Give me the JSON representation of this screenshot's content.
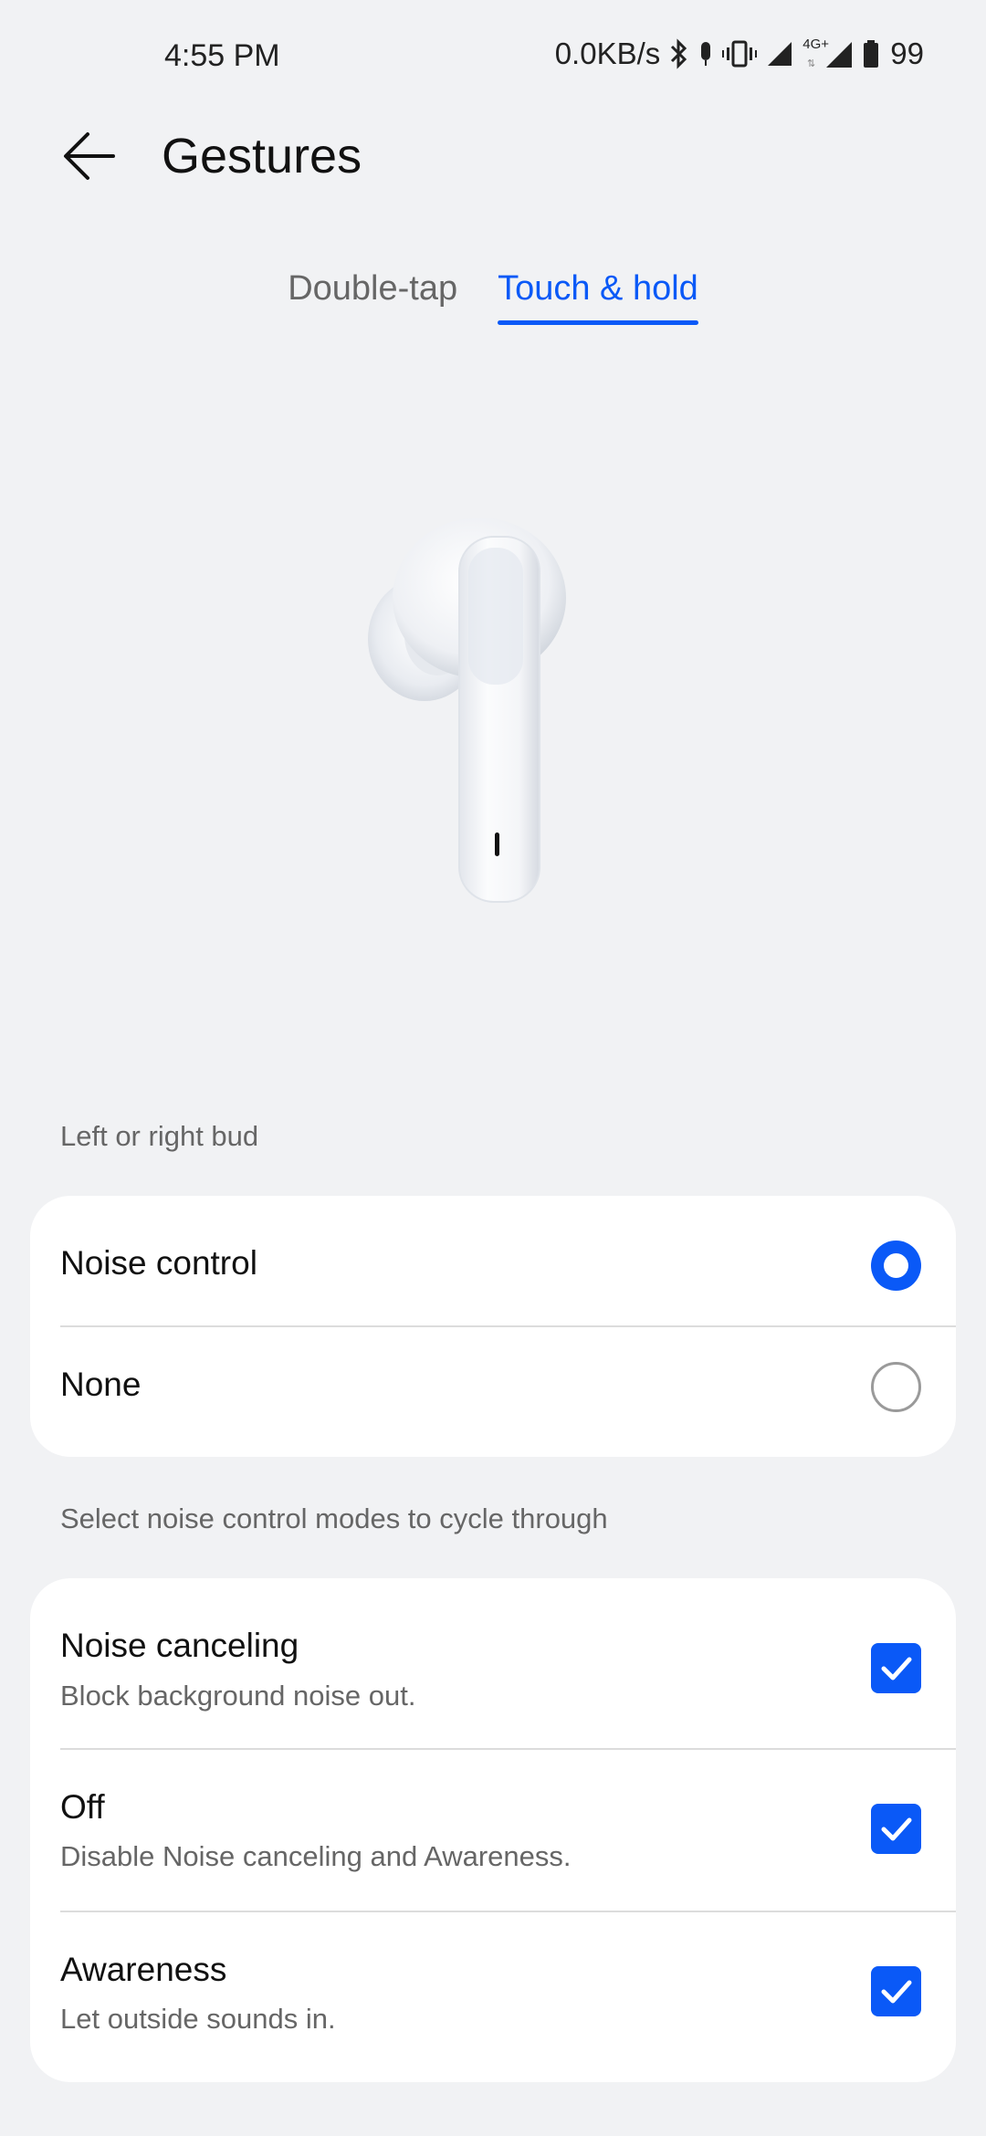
{
  "status_bar": {
    "time": "4:55 PM",
    "net_speed": "0.0KB/s",
    "network_label": "4G+",
    "battery": "99",
    "icons": [
      "bluetooth-icon",
      "mic-icon",
      "vibrate-icon",
      "signal-icon",
      "signal-4g-icon",
      "battery-icon"
    ]
  },
  "header": {
    "title": "Gestures",
    "back_icon": "arrow-left-icon"
  },
  "tabs": [
    {
      "label": "Double-tap",
      "active": false
    },
    {
      "label": "Touch & hold",
      "active": true
    }
  ],
  "colors": {
    "accent": "#0a59f7",
    "background": "#f1f2f4",
    "card": "#ffffff"
  },
  "bud_section": {
    "label": "Left or right bud",
    "options": [
      {
        "label": "Noise control",
        "selected": true
      },
      {
        "label": "None",
        "selected": false
      }
    ]
  },
  "modes_section": {
    "label": "Select noise control modes to cycle through",
    "modes": [
      {
        "title": "Noise canceling",
        "subtitle": "Block background noise out.",
        "checked": true
      },
      {
        "title": "Off",
        "subtitle": "Disable Noise canceling and Awareness.",
        "checked": true
      },
      {
        "title": "Awareness",
        "subtitle": "Let outside sounds in.",
        "checked": true
      }
    ]
  }
}
